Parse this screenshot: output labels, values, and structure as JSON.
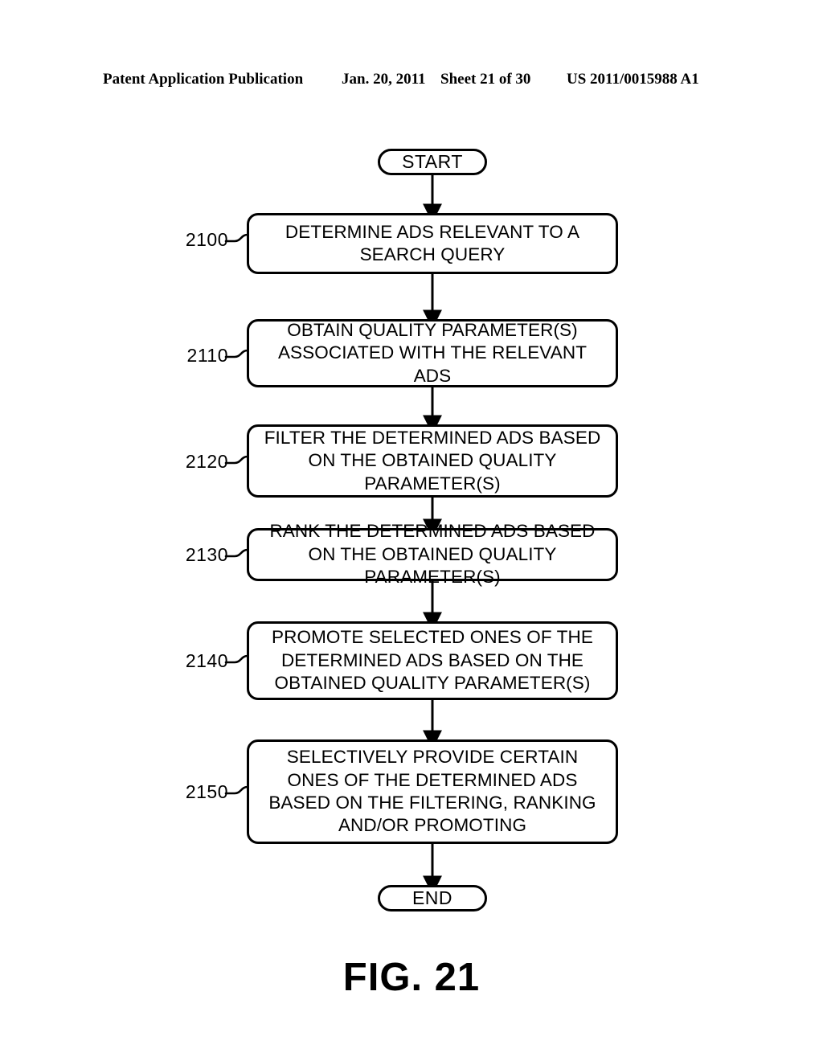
{
  "header": {
    "publication": "Patent Application Publication",
    "date": "Jan. 20, 2011",
    "sheet": "Sheet 21 of 30",
    "document_number": "US 2011/0015988 A1"
  },
  "figure": {
    "caption": "FIG. 21"
  },
  "flowchart": {
    "start_label": "START",
    "end_label": "END",
    "steps": [
      {
        "ref": "2100",
        "text": "DETERMINE ADS RELEVANT TO A SEARCH QUERY"
      },
      {
        "ref": "2110",
        "text": "OBTAIN QUALITY PARAMETER(S) ASSOCIATED WITH THE RELEVANT ADS"
      },
      {
        "ref": "2120",
        "text": "FILTER THE DETERMINED ADS BASED ON THE OBTAINED QUALITY PARAMETER(S)"
      },
      {
        "ref": "2130",
        "text": "RANK THE DETERMINED ADS BASED ON THE OBTAINED QUALITY PARAMETER(S)"
      },
      {
        "ref": "2140",
        "text": "PROMOTE SELECTED ONES OF THE DETERMINED ADS BASED ON THE OBTAINED QUALITY PARAMETER(S)"
      },
      {
        "ref": "2150",
        "text": "SELECTIVELY PROVIDE CERTAIN ONES OF THE DETERMINED ADS BASED ON THE FILTERING, RANKING AND/OR PROMOTING"
      }
    ]
  },
  "colors": {
    "ink": "#000000",
    "paper": "#ffffff"
  }
}
